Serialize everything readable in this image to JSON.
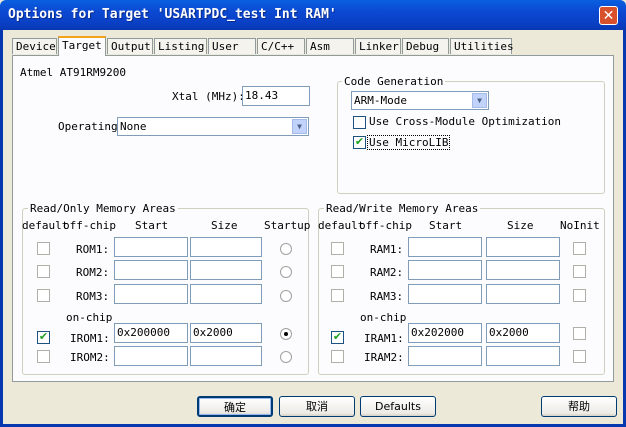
{
  "window": {
    "title": "Options for Target 'USARTPDC_test Int RAM'"
  },
  "tabs": [
    "Device",
    "Target",
    "Output",
    "Listing",
    "User",
    "C/C++",
    "Asm",
    "Linker",
    "Debug",
    "Utilities"
  ],
  "device": "Atmel AT91RM9200",
  "xtal": {
    "label": "Xtal (MHz):",
    "value": "18.43"
  },
  "operating": {
    "label": "Operating",
    "value": "None"
  },
  "code_generation": {
    "title": "Code Generation",
    "mode": "ARM-Mode",
    "cross_module": {
      "label": "Use Cross-Module Optimization",
      "checked": false
    },
    "microlib": {
      "label": "Use MicroLIB",
      "checked": true
    }
  },
  "ro": {
    "title": "Read/Only Memory Areas",
    "headers": {
      "default": "default",
      "offchip": "off-chip",
      "start": "Start",
      "size": "Size",
      "startup": "Startup"
    },
    "onchip": "on-chip",
    "rows": [
      {
        "label": "ROM1:",
        "start": "",
        "size": "",
        "default": false,
        "startup": false
      },
      {
        "label": "ROM2:",
        "start": "",
        "size": "",
        "default": false,
        "startup": false
      },
      {
        "label": "ROM3:",
        "start": "",
        "size": "",
        "default": false,
        "startup": false
      },
      {
        "label": "IROM1:",
        "start": "0x200000",
        "size": "0x2000",
        "default": true,
        "startup": true
      },
      {
        "label": "IROM2:",
        "start": "",
        "size": "",
        "default": false,
        "startup": false
      }
    ]
  },
  "rw": {
    "title": "Read/Write Memory Areas",
    "headers": {
      "default": "default",
      "offchip": "off-chip",
      "start": "Start",
      "size": "Size",
      "noinit": "NoInit"
    },
    "onchip": "on-chip",
    "rows": [
      {
        "label": "RAM1:",
        "start": "",
        "size": "",
        "default": false,
        "noinit": false
      },
      {
        "label": "RAM2:",
        "start": "",
        "size": "",
        "default": false,
        "noinit": false
      },
      {
        "label": "RAM3:",
        "start": "",
        "size": "",
        "default": false,
        "noinit": false
      },
      {
        "label": "IRAM1:",
        "start": "0x202000",
        "size": "0x2000",
        "default": true,
        "noinit": false
      },
      {
        "label": "IRAM2:",
        "start": "",
        "size": "",
        "default": false,
        "noinit": false
      }
    ]
  },
  "buttons": {
    "ok": "确定",
    "cancel": "取消",
    "defaults": "Defaults",
    "help": "帮助"
  }
}
